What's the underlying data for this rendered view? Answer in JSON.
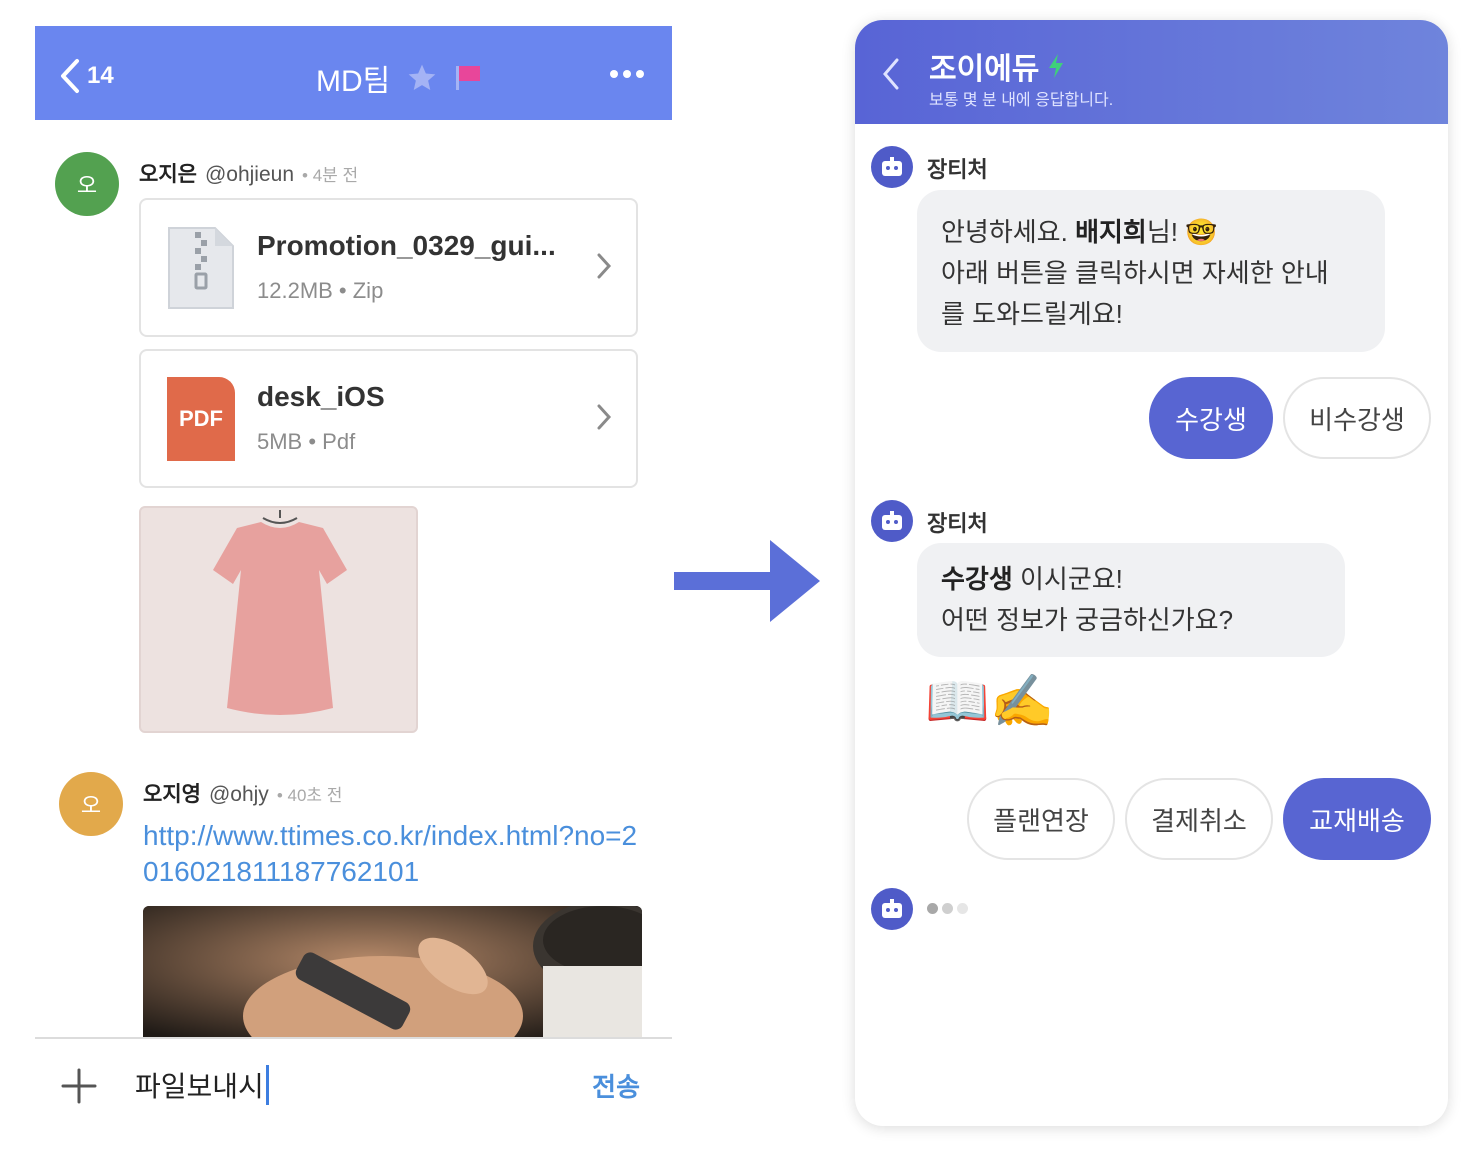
{
  "left_panel": {
    "header": {
      "back_count": "14",
      "title": "MD팀"
    },
    "messages": [
      {
        "avatar_text": "오",
        "avatar_color": "#53a150",
        "name": "오지은",
        "handle": "@ohjieun",
        "time": "4분 전",
        "files": [
          {
            "name": "Promotion_0329_gui...",
            "meta": "12.2MB • Zip",
            "icon": "zip-file-icon"
          },
          {
            "name": "desk_iOS",
            "meta": "5MB • Pdf",
            "icon": "pdf-file-icon",
            "icon_label": "PDF"
          }
        ],
        "image": "pink-dress-photo"
      },
      {
        "avatar_text": "오",
        "avatar_color": "#e2a94b",
        "name": "오지영",
        "handle": "@ohjy",
        "time": "40초 전",
        "link": "http://www.ttimes.co.kr/index.html?no=2016021811187762101",
        "image": "smartphone-coffee-photo"
      }
    ],
    "composer": {
      "value": "파일보내시",
      "send_label": "전송"
    },
    "accent_color": "#6a86ef"
  },
  "right_panel": {
    "header": {
      "title": "조이에듀",
      "subtitle": "보통 몇 분 내에 응답합니다."
    },
    "conversation": [
      {
        "sender": "장티처",
        "bubble": {
          "greeting_prefix": "안녕하세요. ",
          "greeting_name": "배지희",
          "greeting_suffix": "님! 🤓",
          "line2": "아래 버튼을 클릭하시면 자세한 안내",
          "line3": "를 도와드릴게요!"
        },
        "buttons": [
          "수강생",
          "비수강생"
        ]
      },
      {
        "sender": "장티처",
        "bubble": {
          "bold": "수강생",
          "rest": " 이시군요!",
          "line2": "어떤 정보가 궁금하신가요?"
        },
        "emoji": "📖✍️",
        "buttons": [
          "플랜연장",
          "결제취소",
          "교재배송"
        ]
      }
    ],
    "accent_color": "#5865d2"
  }
}
